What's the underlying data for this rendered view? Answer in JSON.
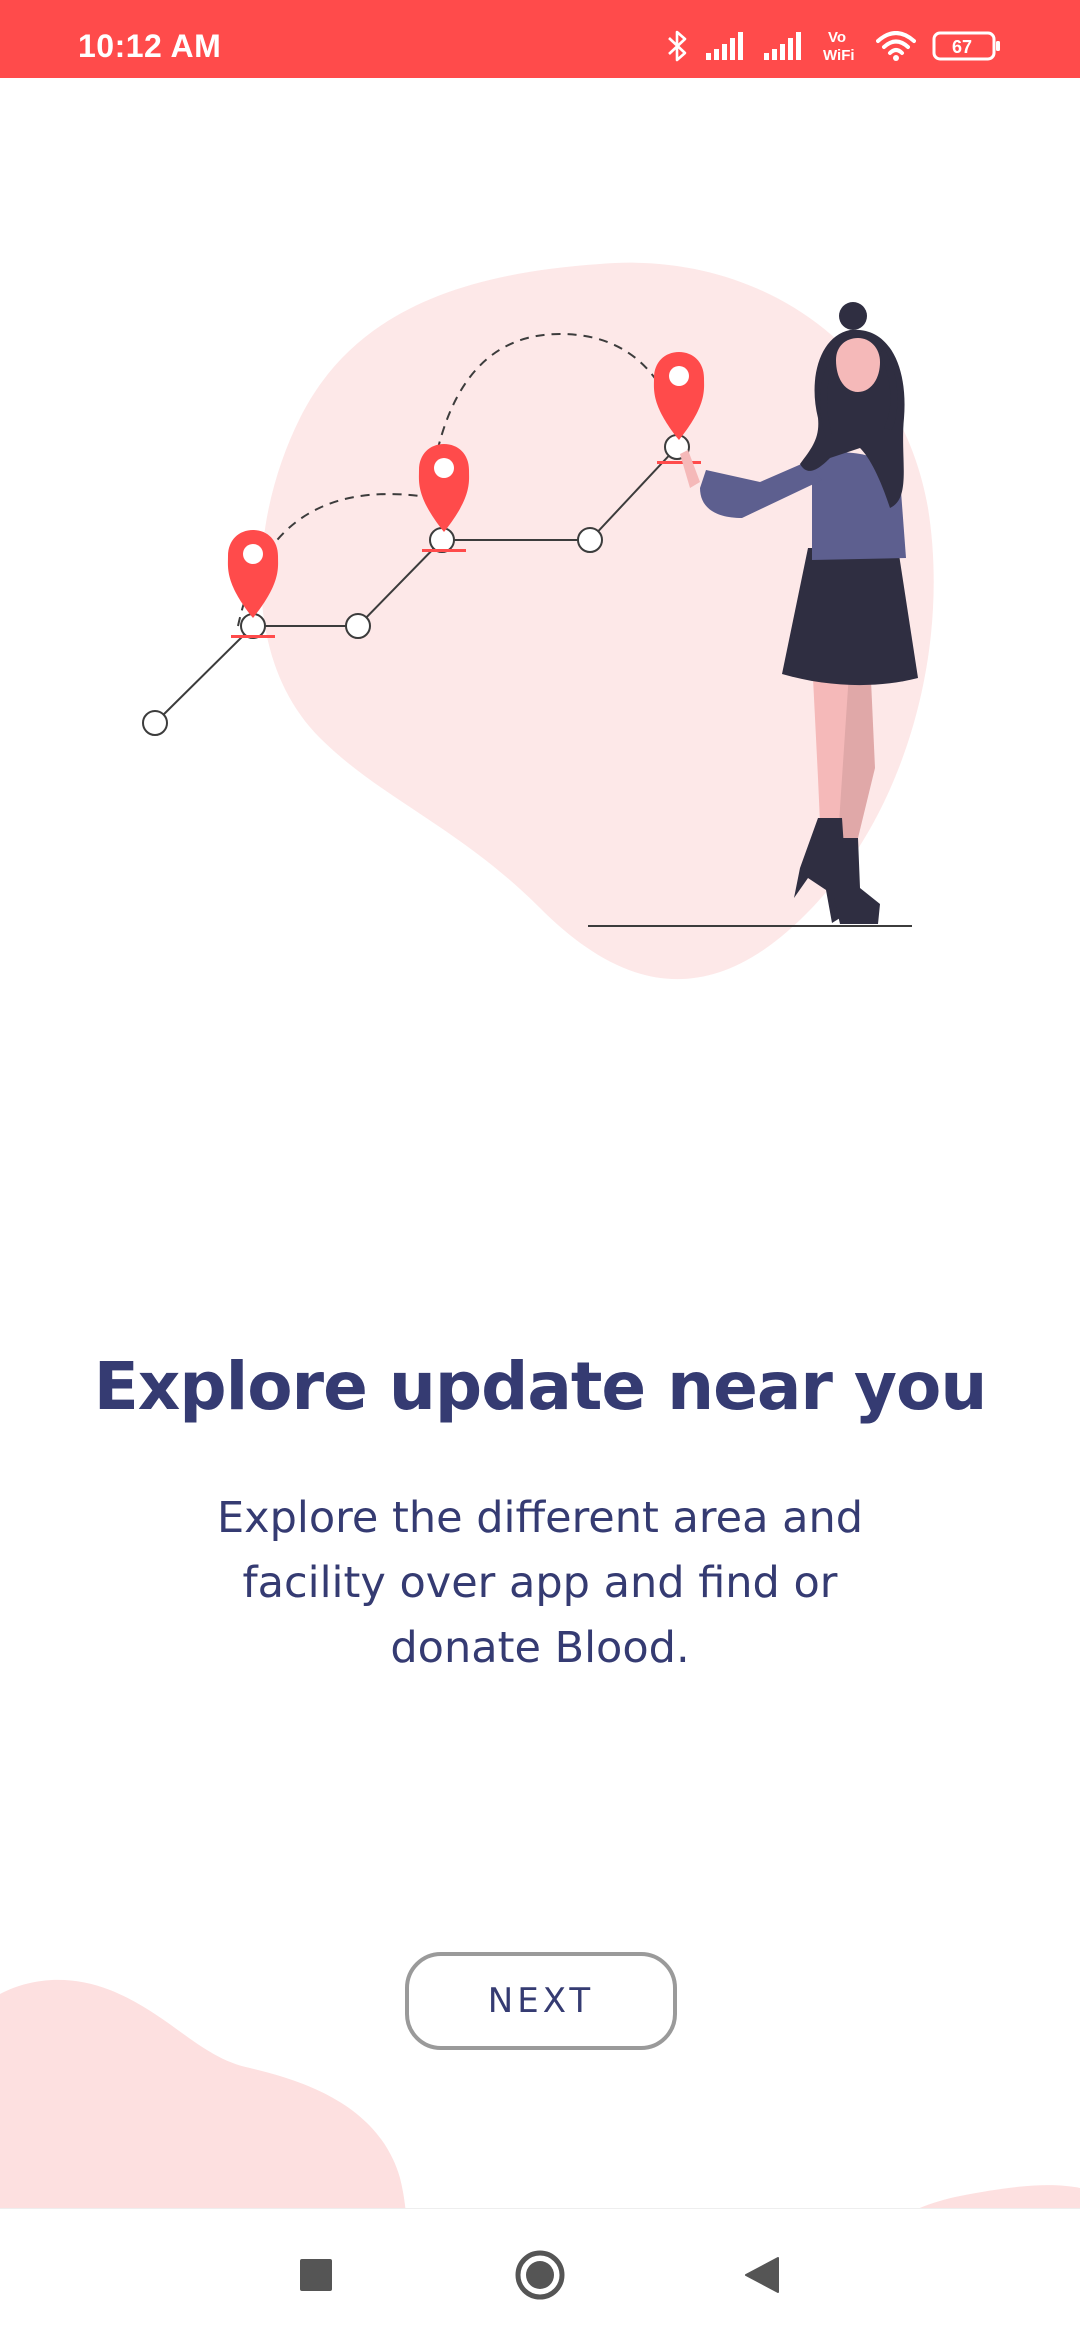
{
  "status_bar": {
    "time": "10:12 AM",
    "battery_level": "67",
    "icons": [
      "bluetooth-icon",
      "signal-icon",
      "signal-icon",
      "vowifi-icon",
      "wifi-icon",
      "battery-icon"
    ],
    "vowifi_top": "Vo",
    "vowifi_bottom": "WiFi"
  },
  "onboarding": {
    "title": "Explore update near you",
    "description_lines": [
      "Explore the different area and",
      "facility over app and find or",
      "donate Blood."
    ],
    "next_label": "NEXT"
  },
  "colors": {
    "accent": "#ff4b4b",
    "text": "#353b72",
    "blob": "#fde4e4"
  },
  "nav_bar": {
    "icons": [
      "recents-square-icon",
      "home-circle-icon",
      "back-triangle-icon"
    ]
  }
}
